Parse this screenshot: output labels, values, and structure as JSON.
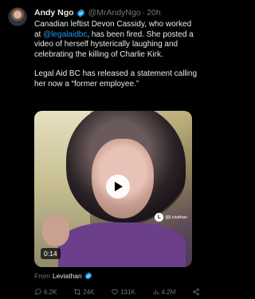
{
  "tweet": {
    "author_name": "Andy Ngo",
    "author_handle": "@MrAndyNgo",
    "separator": "·",
    "timestamp": "20h",
    "body_line1_a": "Canadian leftist Devon Cassidy, who worked at ",
    "mention": "@legalaidbc",
    "body_line1_b": ", has been fired. She posted a video of herself hysterically laughing and celebrating the killing of Charlie Kirk.",
    "body_para2": "Legal Aid BC has released a statement calling her now a “former employee.”"
  },
  "video": {
    "duration": "0:14",
    "watermark": "@Liviathan",
    "watermark_logo": "L"
  },
  "source": {
    "prefix": "From",
    "name": "Leviathan"
  },
  "actions": {
    "replies": "6.2K",
    "reposts": "24K",
    "likes": "131K",
    "views": "4.2M"
  },
  "colors": {
    "background": "#000000",
    "text": "#e7e9ea",
    "muted": "#71767b",
    "accent": "#1d9bf0"
  },
  "icons": [
    "verified-badge-icon",
    "play-icon",
    "reply-icon",
    "repost-icon",
    "like-icon",
    "views-icon",
    "share-icon"
  ]
}
